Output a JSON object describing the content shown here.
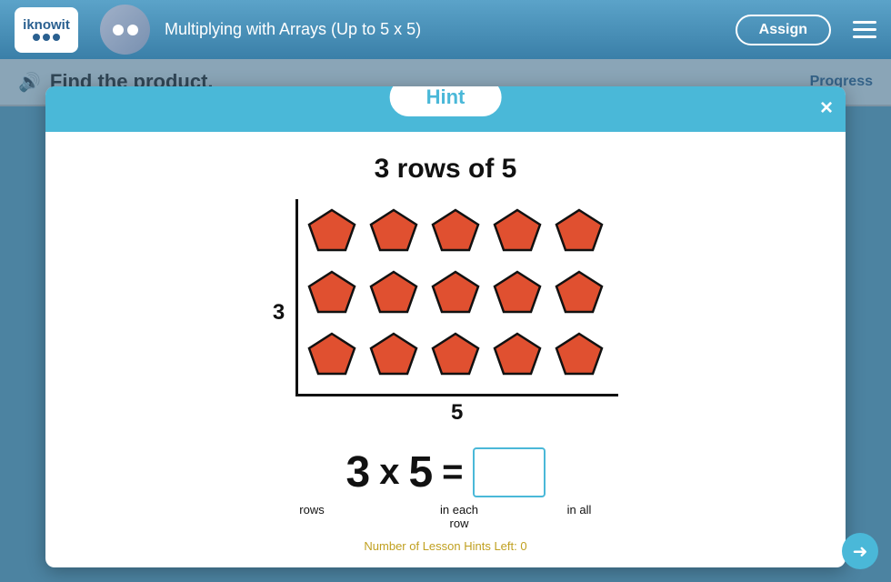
{
  "header": {
    "logo_text": "iknowit",
    "lesson_title": "Multiplying with Arrays (Up to 5 x 5)",
    "assign_label": "Assign",
    "hamburger_label": "Menu"
  },
  "question": {
    "text": "Find the product."
  },
  "progress": {
    "label": "Progress"
  },
  "modal": {
    "hint_label": "Hint",
    "close_label": "×",
    "rows_title": "3 rows of 5",
    "row_count": "3",
    "col_count": "5",
    "eq_rows": "3",
    "eq_operator1": "x",
    "eq_num2": "5",
    "eq_equals": "=",
    "label_rows": "rows",
    "label_each_row": "in each\nrow",
    "label_in_all": "in all",
    "footer": "Number of Lesson Hints Left: 0"
  }
}
